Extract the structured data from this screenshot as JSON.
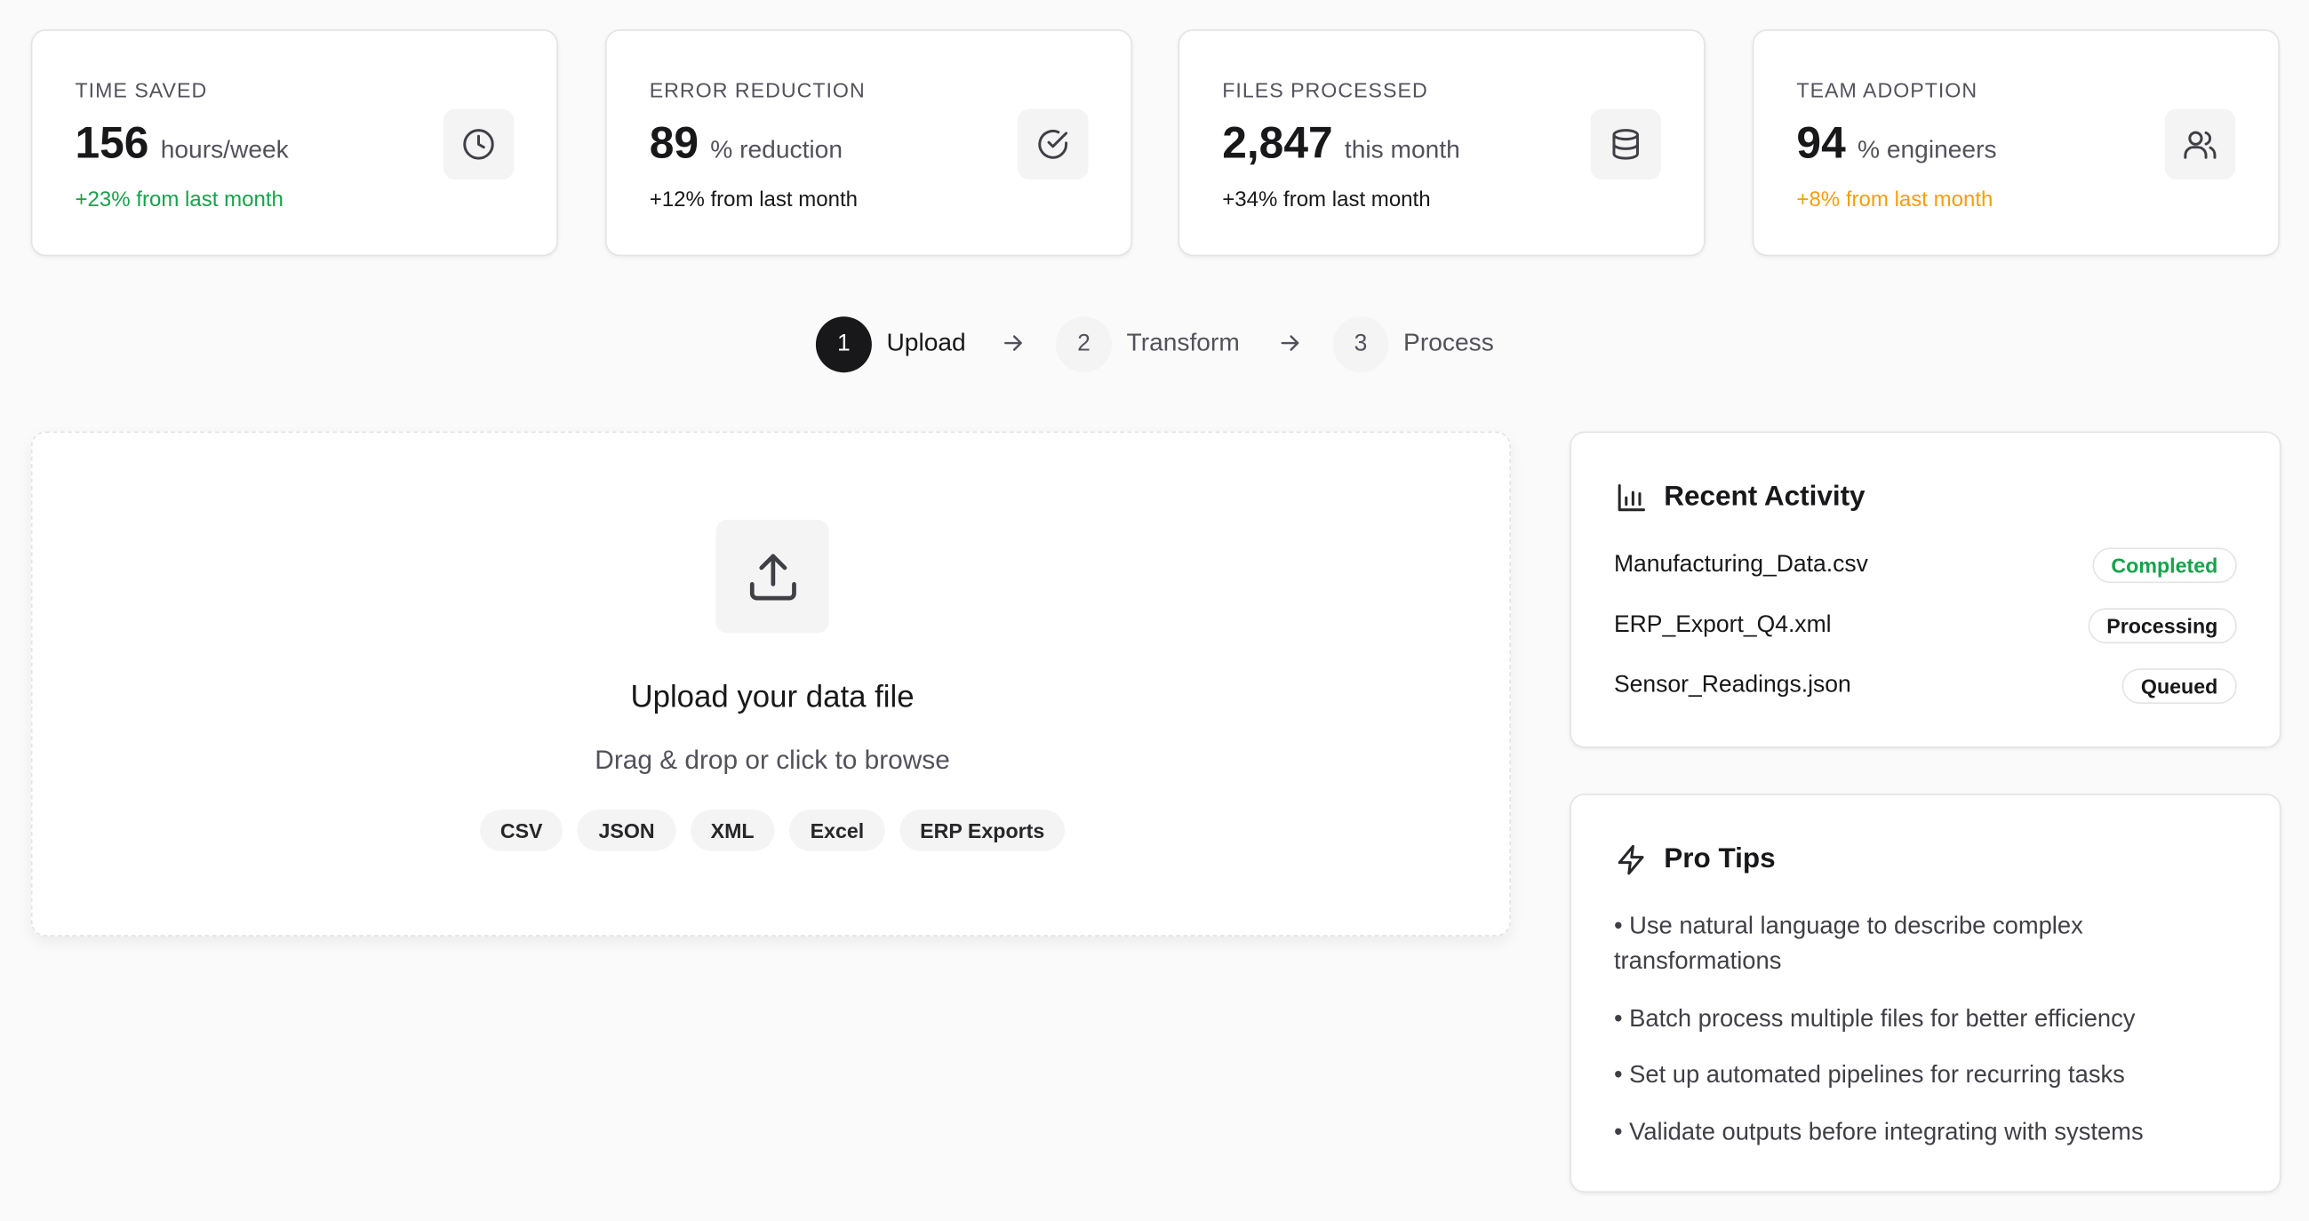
{
  "stats": [
    {
      "label": "TIME SAVED",
      "value": "156",
      "unit": "hours/week",
      "change": "+23% from last month",
      "change_color": "#16a34a",
      "icon": "clock-icon"
    },
    {
      "label": "ERROR REDUCTION",
      "value": "89",
      "unit": "% reduction",
      "change": "+12% from last month",
      "change_color": "#18181b",
      "icon": "check-circle-icon"
    },
    {
      "label": "FILES PROCESSED",
      "value": "2,847",
      "unit": "this month",
      "change": "+34% from last month",
      "change_color": "#18181b",
      "icon": "database-icon"
    },
    {
      "label": "TEAM ADOPTION",
      "value": "94",
      "unit": "% engineers",
      "change": "+8% from last month",
      "change_color": "#f59e0b",
      "icon": "users-icon"
    }
  ],
  "steps": [
    {
      "number": "1",
      "label": "Upload",
      "active": true
    },
    {
      "number": "2",
      "label": "Transform",
      "active": false
    },
    {
      "number": "3",
      "label": "Process",
      "active": false
    }
  ],
  "upload": {
    "title": "Upload your data file",
    "subtitle": "Drag & drop or click to browse",
    "formats": [
      "CSV",
      "JSON",
      "XML",
      "Excel",
      "ERP Exports"
    ]
  },
  "activity": {
    "title": "Recent Activity",
    "items": [
      {
        "name": "Manufacturing_Data.csv",
        "status": "Completed",
        "status_color": "#16a34a"
      },
      {
        "name": "ERP_Export_Q4.xml",
        "status": "Processing",
        "status_color": "#18181b"
      },
      {
        "name": "Sensor_Readings.json",
        "status": "Queued",
        "status_color": "#18181b"
      }
    ]
  },
  "tips": {
    "title": "Pro Tips",
    "items": [
      "• Use natural language to describe complex transformations",
      "• Batch process multiple files for better efficiency",
      "• Set up automated pipelines for recurring tasks",
      "• Validate outputs before integrating with systems"
    ]
  }
}
